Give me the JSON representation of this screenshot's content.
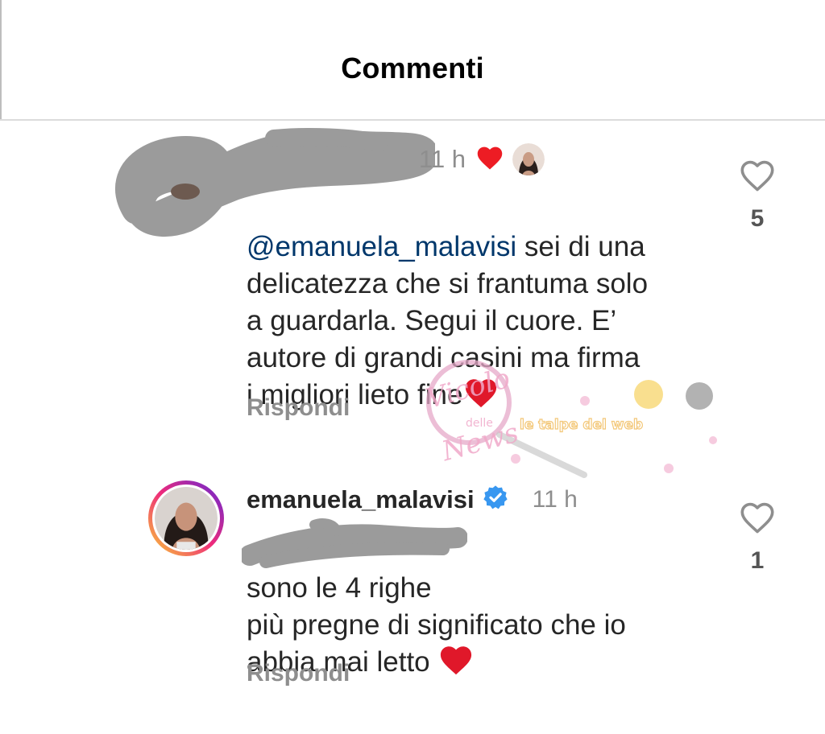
{
  "header": {
    "title": "Commenti"
  },
  "comments": [
    {
      "username": "",
      "time": "11 h",
      "mention": "@emanuela_malavisi",
      "text": " sei di una\ndelicatezza che si frantuma solo\na guardarla. Segui il cuore. E’\nautore di grandi casini ma firma\ni migliori lieto fine",
      "reply_label": "Rispondi",
      "like_count": "5",
      "author_liked_icon": "heart-filled-icon",
      "author_avatar_icon": "avatar-icon"
    },
    {
      "username": "emanuela_malavisi",
      "verified_icon": "verified-badge-icon",
      "time": "11 h",
      "mention": "",
      "text": "sono le 4 righe\npiù pregne di significato che io\nabbia mai letto ",
      "reply_label": "Rispondi",
      "like_count": "1"
    }
  ],
  "watermark": {
    "logo_text": "Vicolo delle News",
    "tagline": "le talpe del web"
  },
  "colors": {
    "heart_red": "#ed1c24",
    "verified_blue": "#3897f0",
    "mention_blue": "#00376b",
    "muted_gray": "#8e8e8e",
    "redaction_gray": "#9b9b9b"
  }
}
